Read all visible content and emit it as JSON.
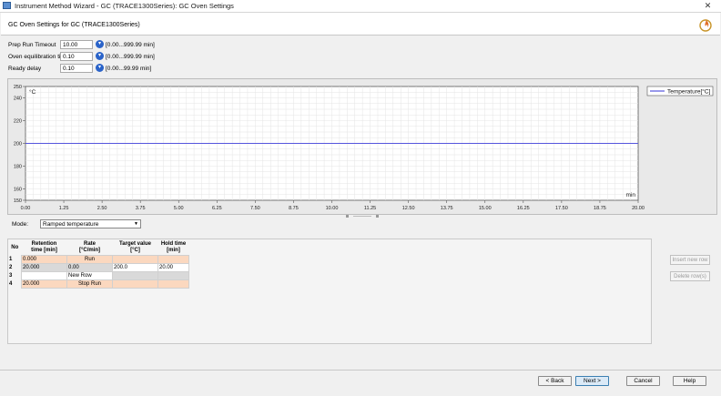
{
  "window": {
    "title": "Instrument Method Wizard - GC (TRACE1300Series): GC Oven Settings",
    "close_glyph": "✕"
  },
  "header": {
    "text": "GC Oven Settings for GC (TRACE1300Series)"
  },
  "params": [
    {
      "label": "Prep Run Timeout",
      "value": "10.00",
      "range": "[0.00...999.99 min]"
    },
    {
      "label": "Oven equilibration time",
      "value": "0.10",
      "range": "[0.00...999.99 min]"
    },
    {
      "label": "Ready delay",
      "value": "0.10",
      "range": "[0.00...99.99 min]"
    }
  ],
  "chart_data": {
    "type": "line",
    "ylabel": "°C",
    "xlabel": "min",
    "ylim": [
      150,
      250
    ],
    "xlim": [
      0,
      20
    ],
    "yticks": [
      "250",
      "240",
      "220",
      "200",
      "180",
      "160",
      "150"
    ],
    "xticks": [
      "0.00",
      "1.25",
      "2.50",
      "3.75",
      "5.00",
      "6.25",
      "7.50",
      "8.75",
      "10.00",
      "11.25",
      "12.50",
      "13.75",
      "15.00",
      "16.25",
      "17.50",
      "18.75",
      "20.00"
    ],
    "grid": true,
    "legend_position": "top-right",
    "series": [
      {
        "name": "Temperature[°C]",
        "color": "#5555dd",
        "x": [
          0,
          20
        ],
        "y": [
          200,
          200
        ]
      }
    ]
  },
  "mode": {
    "label": "Mode:",
    "selected": "Ramped temperature"
  },
  "table": {
    "headers": {
      "no": "No",
      "ret1": "Retention",
      "ret2": "time [min]",
      "rate1": "Rate",
      "rate2": "[°C/min]",
      "tgt1": "Target value",
      "tgt2": "[°C]",
      "hold1": "Hold time",
      "hold2": "[min]"
    },
    "rows": [
      {
        "no": "1",
        "ret": "0.000",
        "rate": "Run",
        "target": "",
        "hold": ""
      },
      {
        "no": "2",
        "ret": "20.000",
        "rate": "0.00",
        "target": "200.0",
        "hold": "20.00"
      },
      {
        "no": "3",
        "ret": "",
        "rate": "New Row",
        "target": "",
        "hold": ""
      },
      {
        "no": "4",
        "ret": "20.000",
        "rate": "Stop Run",
        "target": "",
        "hold": ""
      }
    ]
  },
  "side_buttons": {
    "insert": "Insert new row",
    "delete": "Delete row(s)"
  },
  "footer": {
    "back": "< Back",
    "next": "Next >",
    "cancel": "Cancel",
    "help": "Help"
  }
}
